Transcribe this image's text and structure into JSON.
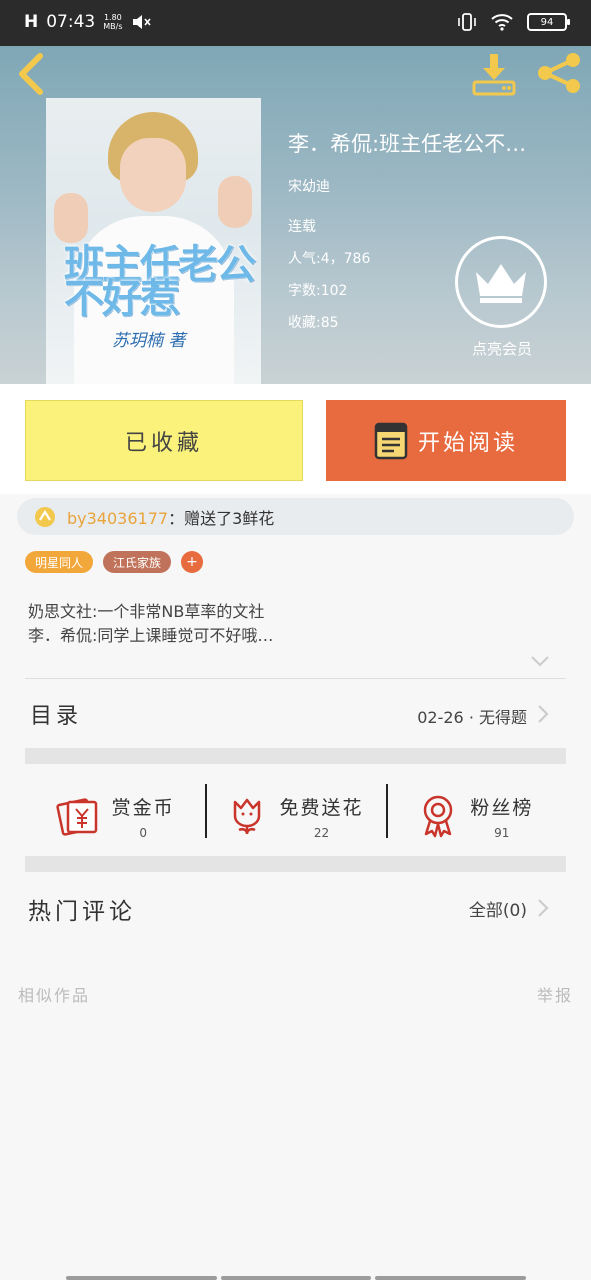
{
  "status_bar": {
    "signal": "H",
    "time": "07:43",
    "speed_value": "1.80",
    "speed_unit": "MB/s",
    "battery": "94"
  },
  "header": {
    "cover": {
      "title": "班主任老公不好惹",
      "author": "苏玥楠 著"
    },
    "book_title": "李．希侃:班主任老公不…",
    "author": "宋幼迪",
    "status": "连载",
    "popularity": "人气:4，786",
    "word_count": "字数:102",
    "favorites": "收藏:85",
    "vip_label": "点亮会员"
  },
  "actions": {
    "favorite_label": "已收藏",
    "read_label": "开始阅读"
  },
  "gift": {
    "user": "by34036177",
    "message": "：赠送了3鲜花"
  },
  "tags": [
    {
      "label": "明星同人",
      "color": "#f2a73a"
    },
    {
      "label": "江氏家族",
      "color": "#c0735a"
    }
  ],
  "tag_add": "+",
  "synopsis": {
    "line1": "奶思文社:一个非常NB草率的文社",
    "line2": "李．希侃:同学上课睡觉可不好哦…"
  },
  "toc": {
    "label": "目录",
    "latest": "02-26 · 无得题"
  },
  "stats": [
    {
      "name": "赏金币",
      "value": "0",
      "icon": "red-envelope-icon"
    },
    {
      "name": "免费送花",
      "value": "22",
      "icon": "flower-icon"
    },
    {
      "name": "粉丝榜",
      "value": "91",
      "icon": "medal-icon"
    }
  ],
  "comments": {
    "label": "热门评论",
    "all": "全部(0)"
  },
  "footer": {
    "similar": "相似作品",
    "report": "举报"
  },
  "colors": {
    "accent_orange": "#e86a3f",
    "favorite_yellow": "#faf27a",
    "icon_red": "#c9352b",
    "icon_gold": "#f2c94c"
  }
}
